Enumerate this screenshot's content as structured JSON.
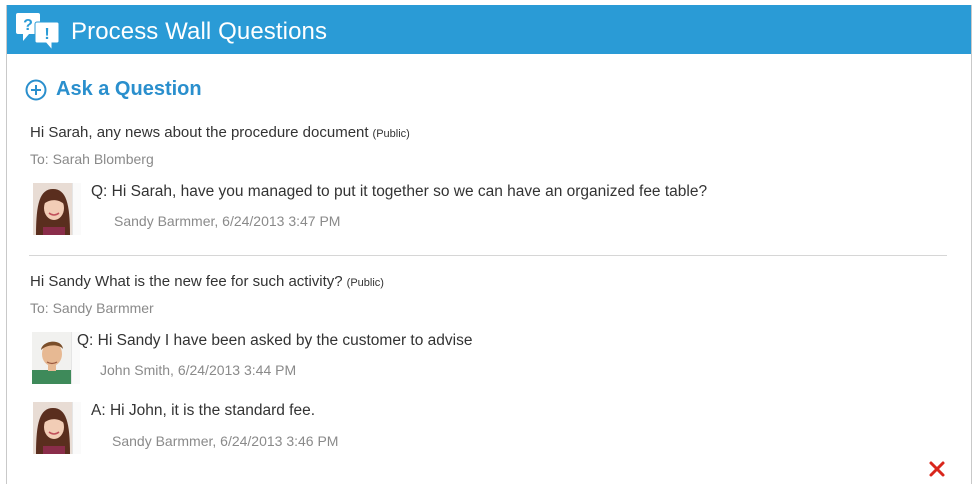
{
  "header": {
    "title": "Process Wall Questions",
    "icon": "question-exclamation-icon",
    "color": "#2a9bd6"
  },
  "ask": {
    "label": "Ask a Question",
    "icon": "plus-circle-icon",
    "color": "#2a8fcd"
  },
  "threads": [
    {
      "title": "Hi Sarah, any news about the procedure document",
      "visibility": "(Public)",
      "to": "To: Sarah Blomberg",
      "messages": [
        {
          "text": "Q: Hi Sarah, have you managed to put it together so we can have an organized fee table?",
          "meta": "Sandy Barmmer, 6/24/2013 3:47 PM",
          "avatar": "woman-avatar"
        }
      ]
    },
    {
      "title": "Hi Sandy What is the new fee for such activity?",
      "visibility": "(Public)",
      "to": "To: Sandy Barmmer",
      "messages": [
        {
          "text": "Q: Hi Sandy I have been asked by the customer to advise",
          "meta": "John Smith, 6/24/2013 3:44 PM",
          "avatar": "man-avatar"
        },
        {
          "text": "A: Hi John, it is the standard fee.",
          "meta": "Sandy Barmmer, 6/24/2013 3:46 PM",
          "avatar": "woman-avatar"
        }
      ]
    }
  ],
  "close": {
    "icon": "close-x-icon",
    "color": "#d9261c"
  }
}
